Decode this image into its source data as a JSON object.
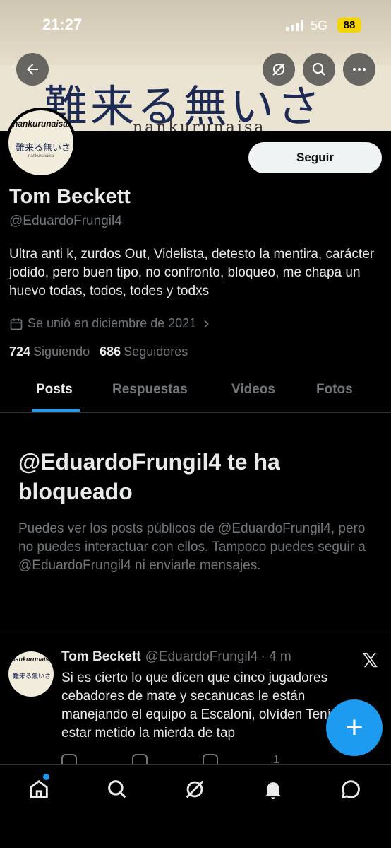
{
  "status_bar": {
    "time": "21:27",
    "network": "5G",
    "battery": "88"
  },
  "banner": {
    "text": "難来る無いさ",
    "subtext": "nankurunaisa"
  },
  "avatar": {
    "top_text": "nankurunaisa",
    "mid_text": "難来る無いさ",
    "bottom_text": "nankurunaisa"
  },
  "header": {
    "back_icon": "back-arrow-icon",
    "grok_icon": "grok-icon",
    "search_icon": "search-icon",
    "more_icon": "more-icon"
  },
  "profile": {
    "follow_label": "Seguir",
    "name": "Tom Beckett",
    "handle": "@EduardoFrungil4",
    "bio": "Ultra anti k, zurdos Out, Videlista, detesto la mentira, carácter jodido, pero buen tipo, no confronto, bloqueo, me chapa un huevo todas, todos, todes y todxs",
    "joined": "Se unió en diciembre de 2021",
    "following_count": "724",
    "following_label": "Siguiendo",
    "followers_count": "686",
    "followers_label": "Seguidores"
  },
  "tabs": [
    {
      "label": "Posts",
      "active": true
    },
    {
      "label": "Respuestas",
      "active": false
    },
    {
      "label": "Videos",
      "active": false
    },
    {
      "label": "Fotos",
      "active": false
    }
  ],
  "blocked": {
    "title": "@EduardoFrungil4 te ha bloqueado",
    "description": "Puedes ver los posts públicos de @EduardoFrungil4, pero no puedes interactuar con ellos. Tampoco puedes seguir a @EduardoFrungil4 ni enviarle mensajes."
  },
  "post": {
    "name": "Tom Beckett",
    "handle": "@EduardoFrungil4",
    "time": "· 4 m",
    "text": "Si es cierto lo que dicen que cinco jugadores cebadores de mate y secanucas le están manejando el equipo a Escaloni, olvíden Tenía que estar metido la mierda de tap",
    "views": "1"
  },
  "nav": [
    "home-icon",
    "search-icon",
    "grok-icon",
    "notifications-icon",
    "messages-icon"
  ],
  "colors": {
    "accent": "#1d9bf0",
    "background": "#000000",
    "secondary_text": "#71767b"
  }
}
